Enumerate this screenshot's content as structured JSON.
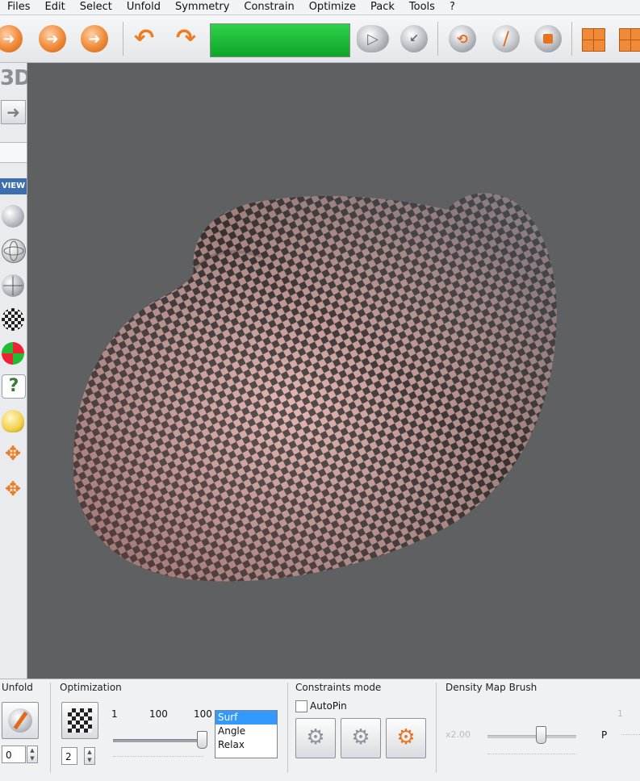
{
  "menu": [
    "Files",
    "Edit",
    "Select",
    "Unfold",
    "Symmetry",
    "Constrain",
    "Optimize",
    "Pack",
    "Tools",
    "?"
  ],
  "left_panel": {
    "mode_label": "3D",
    "view_label": "VIEW"
  },
  "bottom": {
    "unfold": {
      "title": "Unfold",
      "value": "0"
    },
    "optimization": {
      "title": "Optimization",
      "value": "2",
      "label_min": "1",
      "label_mid": "100",
      "label_max": "100",
      "slider_fraction": 0.98,
      "options": [
        "Surf",
        "Angle",
        "Relax"
      ],
      "selected": "Surf"
    },
    "constraints": {
      "title": "Constraints mode",
      "autopin_label": "AutoPin",
      "autopin_checked": false
    },
    "density": {
      "title": "Density Map Brush",
      "value": "x2.00",
      "small_label": "1",
      "p_label": "P",
      "slider_fraction": 0.6
    }
  },
  "icons": {
    "toolbar": [
      "open-icon",
      "save-icon",
      "export-icon",
      "undo-icon",
      "redo-icon",
      "progress-bar",
      "select-mode-icon",
      "reset-icon",
      "rotate-icon",
      "seam-icon",
      "stop-icon",
      "pack-icon"
    ],
    "left": [
      "arrow-icon",
      "sphere-icon",
      "globe-wire-icon",
      "globe-icon",
      "checker-sphere-icon",
      "color-sphere-icon",
      "help-icon",
      "light-icon",
      "move-icon",
      "center-icon"
    ]
  },
  "colors": {
    "accent": "#f08a38",
    "progress": "#19b834",
    "viewport_bg": "#5f6061",
    "selection": "#3399ff"
  }
}
